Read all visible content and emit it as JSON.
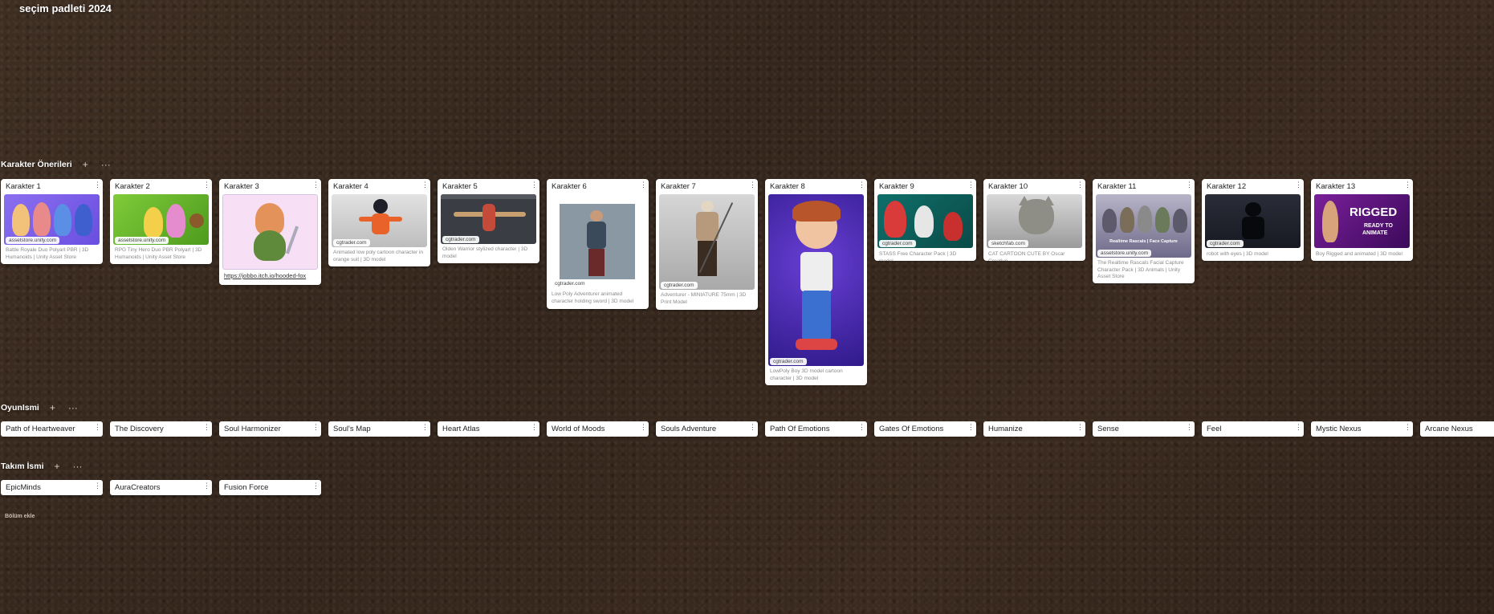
{
  "board": {
    "title": "seçim padleti 2024"
  },
  "sections": {
    "characters": {
      "title": "Karakter Önerileri",
      "add_icon": "+",
      "more_icon": "···",
      "cards": [
        {
          "title": "Karakter 1",
          "domain": "assetstore.unity.com",
          "desc": "Battle Royale Duo Polyart PBR | 3D Humanoids | Unity Asset Store"
        },
        {
          "title": "Karakter 2",
          "domain": "assetstore.unity.com",
          "desc": "RPG Tiny Hero Duo PBR Polyart | 3D Humanoids | Unity Asset Store"
        },
        {
          "title": "Karakter 3",
          "link": "https://jobbo.itch.io/hooded-fox"
        },
        {
          "title": "Karakter 4",
          "domain": "cgtrader.com",
          "desc": "Animated low poly cartoon character in orange suit | 3D model"
        },
        {
          "title": "Karakter 5",
          "domain": "cgtrader.com",
          "desc": "Olden Warrior stylized character | 3D model"
        },
        {
          "title": "Karakter 6",
          "domain": "cgtrader.com",
          "desc": "Low Poly Adventurer animated character holding sword | 3D model"
        },
        {
          "title": "Karakter 7",
          "domain": "cgtrader.com",
          "desc": "Adventurer - MINIATURE 75mm | 3D Print Model"
        },
        {
          "title": "Karakter 8",
          "domain": "cgtrader.com",
          "desc": "LowPoly Boy 3D model cartoon character | 3D model"
        },
        {
          "title": "Karakter 9",
          "domain": "cgtrader.com",
          "desc": "STASS Free Character Pack | 3D model"
        },
        {
          "title": "Karakter 10",
          "domain": "sketchfab.com",
          "desc": "CAT CARTOON CUTE BY Oscar Creativo"
        },
        {
          "title": "Karakter 11",
          "domain": "assetstore.unity.com",
          "desc": "The Realtime Rascals Facial Capture Character Pack | 3D Animals | Unity Asset Store",
          "thumb_text": "Realtime Rascals | Face Capture"
        },
        {
          "title": "Karakter 12",
          "domain": "cgtrader.com",
          "desc": "robot with eyes | 3D model"
        },
        {
          "title": "Karakter 13",
          "domain": "cgtrader.com",
          "desc": "Boy Rigged and animated | 3D model",
          "thumb_text_1": "RIGGED",
          "thumb_text_2": "READY TO",
          "thumb_text_3": "ANIMATE"
        }
      ]
    },
    "game_name": {
      "title": "OyunIsmi",
      "add_icon": "+",
      "more_icon": "···",
      "items": [
        "Path of Heartweaver",
        "The Discovery",
        "Soul Harmonizer",
        "Soul's Map",
        "Heart Atlas",
        "World of Moods",
        "Souls Adventure",
        "Path Of Emotions",
        "Gates Of Emotions",
        "Humanize",
        "Sense",
        "Feel",
        "Mystic Nexus",
        "Arcane Nexus"
      ]
    },
    "team_name": {
      "title": "Takım İsmi",
      "add_icon": "+",
      "more_icon": "···",
      "items": [
        "EpicMinds",
        "AuraCreators",
        "Fusion Force"
      ]
    }
  },
  "add_section_label": "Bölüm ekle",
  "card_menu_icon": "⋮",
  "colors": {
    "background": "#3b2b20",
    "card": "#ffffff"
  }
}
